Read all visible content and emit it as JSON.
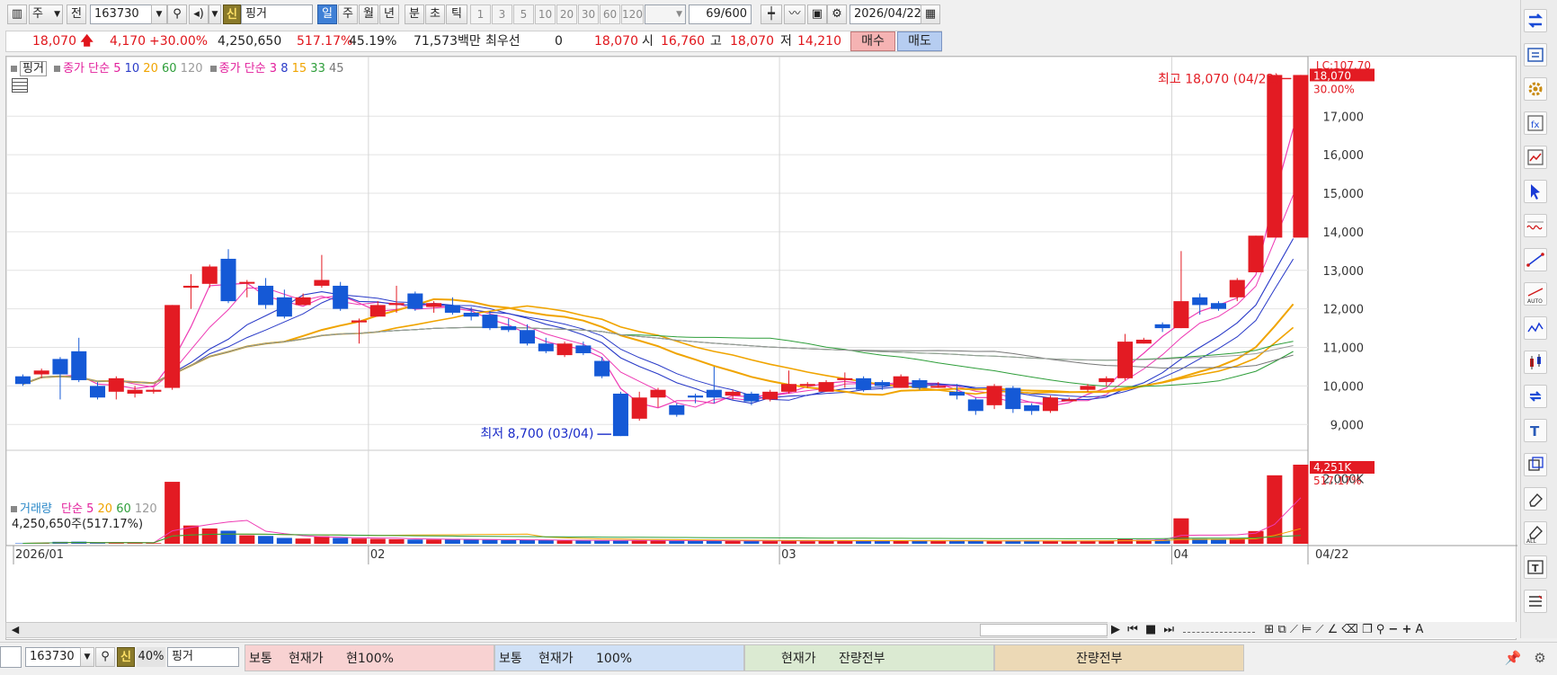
{
  "toolbar": {
    "market_type": "주",
    "all_label": "전",
    "code": "163730",
    "new_badge": "신",
    "stock_name": "핑거",
    "tabs": [
      "일",
      "주",
      "월",
      "년",
      "분",
      "초",
      "틱"
    ],
    "active_tab": "일",
    "periods": [
      "1",
      "3",
      "5",
      "10",
      "20",
      "30",
      "60",
      "120"
    ],
    "count": "69",
    "count_max": "/600",
    "date": "2026/04/22"
  },
  "quote": {
    "price": "18,070",
    "change": "4,170",
    "change_pct": "+30.00%",
    "volume": "4,250,650",
    "vol_ratio": "517.17%",
    "turnover": "45.19%",
    "amount": "71,573백만",
    "priority_label": "최우선",
    "priority_value": "0",
    "current": "18,070",
    "open_label": "시",
    "open": "16,760",
    "high_label": "고",
    "high": "18,070",
    "low_label": "저",
    "low": "14,210",
    "buy_label": "매수",
    "sell_label": "매도"
  },
  "price_legend": {
    "name": "핑거",
    "ma1_label": "종가 단순",
    "ma1_periods": [
      "5",
      "10",
      "20",
      "60",
      "120"
    ],
    "ma2_label": "종가 단순",
    "ma2_periods": [
      "3",
      "8",
      "15",
      "33",
      "45"
    ]
  },
  "volume_legend": {
    "name": "거래량",
    "ma_label": "단순",
    "ma_periods": [
      "5",
      "20",
      "60",
      "120"
    ],
    "value_text": "4,250,650주(517.17%)"
  },
  "colors": {
    "up": "#e31b23",
    "down": "#1559d6",
    "ma5": "#ee3bb4",
    "ma10": "#2a3bc8",
    "ma20": "#f0a400",
    "ma60": "#2e9e3a",
    "ma120": "#9b9b9b"
  },
  "chart_data": {
    "type": "candlestick",
    "ylim": [
      8400,
      18500
    ],
    "y_ticks": [
      "9,000",
      "10,000",
      "11,000",
      "12,000",
      "13,000",
      "14,000",
      "15,000",
      "16,000",
      "17,000"
    ],
    "y_right_top_label": "LC:107.70",
    "last_price_tag": "18,070",
    "last_pct_tag": "30.00%",
    "max_annotation": "최고 18,070 (04/22)",
    "min_annotation": "최저 8,700 (03/04)",
    "x_labels": [
      "2026/01",
      "02",
      "03",
      "04"
    ],
    "x_end_label": "04/22",
    "candles": [
      [
        10250,
        10050,
        10300,
        10000
      ],
      [
        10300,
        10400,
        10450,
        10200
      ],
      [
        10700,
        10300,
        10750,
        9650
      ],
      [
        10900,
        10150,
        11250,
        10100
      ],
      [
        10000,
        9700,
        10100,
        9650
      ],
      [
        9850,
        10200,
        10250,
        9650
      ],
      [
        9800,
        9900,
        10000,
        9700
      ],
      [
        9850,
        9900,
        9950,
        9800
      ],
      [
        9950,
        12100,
        12100,
        9900
      ],
      [
        12550,
        12600,
        12900,
        12000
      ],
      [
        12650,
        13100,
        13150,
        12550
      ],
      [
        13300,
        12200,
        13550,
        12150
      ],
      [
        12700,
        12700,
        12750,
        12300
      ],
      [
        12600,
        12100,
        12800,
        12000
      ],
      [
        12300,
        11800,
        12500,
        11750
      ],
      [
        12100,
        12300,
        12400,
        12100
      ],
      [
        12600,
        12750,
        13400,
        12550
      ],
      [
        12600,
        12000,
        12700,
        11950
      ],
      [
        11650,
        11700,
        11750,
        11100
      ],
      [
        11800,
        12100,
        12200,
        11800
      ],
      [
        12100,
        12150,
        12600,
        11900
      ],
      [
        12400,
        12000,
        12450,
        11950
      ],
      [
        12050,
        12150,
        12200,
        11900
      ],
      [
        12100,
        11900,
        12300,
        11850
      ],
      [
        11900,
        11800,
        12050,
        11700
      ],
      [
        11850,
        11500,
        11950,
        11450
      ],
      [
        11550,
        11450,
        11750,
        11400
      ],
      [
        11450,
        11100,
        11600,
        11050
      ],
      [
        11100,
        10900,
        11250,
        10850
      ],
      [
        10800,
        11100,
        11150,
        10750
      ],
      [
        11050,
        10850,
        11150,
        10800
      ],
      [
        10650,
        10250,
        10750,
        10200
      ],
      [
        9800,
        8700,
        9850,
        8700
      ],
      [
        9150,
        9700,
        9850,
        9100
      ],
      [
        9700,
        9900,
        9950,
        9450
      ],
      [
        9500,
        9250,
        9550,
        9200
      ],
      [
        9750,
        9700,
        9800,
        9550
      ],
      [
        9900,
        9700,
        10500,
        9550
      ],
      [
        9750,
        9850,
        9900,
        9650
      ],
      [
        9800,
        9600,
        9850,
        9500
      ],
      [
        9650,
        9850,
        9900,
        9600
      ],
      [
        9850,
        10050,
        10400,
        9800
      ],
      [
        10050,
        10050,
        10100,
        9950
      ],
      [
        9850,
        10100,
        10150,
        9850
      ],
      [
        10200,
        10200,
        10350,
        9950
      ],
      [
        10200,
        9900,
        10250,
        9850
      ],
      [
        10100,
        10000,
        10150,
        9900
      ],
      [
        9950,
        10250,
        10300,
        9950
      ],
      [
        10150,
        9950,
        10200,
        9900
      ],
      [
        10000,
        10000,
        10100,
        9950
      ],
      [
        9850,
        9750,
        10050,
        9650
      ],
      [
        9650,
        9350,
        9700,
        9250
      ],
      [
        9500,
        10000,
        10050,
        9400
      ],
      [
        9950,
        9400,
        10000,
        9300
      ],
      [
        9500,
        9350,
        9550,
        9250
      ],
      [
        9350,
        9700,
        9750,
        9300
      ],
      [
        9650,
        9650,
        9700,
        9600
      ],
      [
        9900,
        10000,
        10050,
        9850
      ],
      [
        10100,
        10200,
        10250,
        10000
      ],
      [
        10200,
        11150,
        11350,
        10150
      ],
      [
        11100,
        11200,
        11250,
        11100
      ],
      [
        11600,
        11500,
        11650,
        11400
      ],
      [
        11500,
        12200,
        13500,
        11500
      ],
      [
        12300,
        12100,
        12400,
        11850
      ],
      [
        12150,
        12000,
        12200,
        11950
      ],
      [
        12300,
        12750,
        12800,
        12200
      ],
      [
        12950,
        13900,
        13900,
        12950
      ],
      [
        13850,
        18070,
        18070,
        14210
      ],
      [
        13850,
        18070,
        18070,
        14210
      ]
    ],
    "volumes": [
      14,
      22,
      60,
      65,
      22,
      22,
      20,
      20,
      1900,
      560,
      470,
      400,
      260,
      240,
      180,
      160,
      230,
      180,
      160,
      150,
      140,
      130,
      130,
      140,
      130,
      120,
      110,
      110,
      110,
      100,
      110,
      100,
      110,
      100,
      100,
      90,
      90,
      100,
      90,
      90,
      90,
      90,
      80,
      90,
      100,
      90,
      90,
      100,
      90,
      90,
      100,
      90,
      80,
      90,
      80,
      90,
      80,
      90,
      100,
      140,
      120,
      130,
      780,
      150,
      140,
      180,
      390,
      2100,
      4250
    ],
    "volume_ylim": [
      0,
      2150
    ],
    "volume_y_tick": "2,000K",
    "volume_last_tag": "4,251K",
    "volume_last_pct": "517.17%"
  },
  "bottom_bar": {
    "code": "163730",
    "new_badge": "신",
    "percent": "40%",
    "name": "핑거",
    "panel1": [
      "보통",
      "현재가",
      "현100%"
    ],
    "panel2": [
      "보통",
      "현재가",
      "100%"
    ],
    "panel3": [
      "현재가",
      "잔량전부"
    ],
    "panel4": [
      "잔량전부"
    ]
  }
}
